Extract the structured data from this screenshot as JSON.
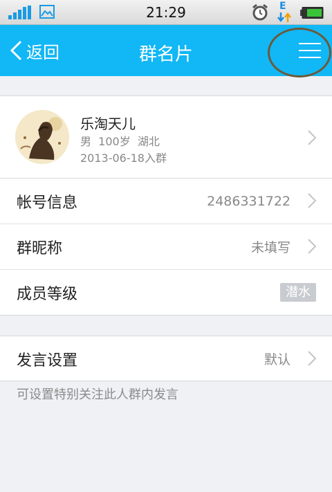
{
  "status_bar": {
    "time": "21:29",
    "icons": [
      "signal-icon",
      "picture-icon",
      "alarm-icon",
      "network-e-icon",
      "battery-icon"
    ],
    "network_letter": "E"
  },
  "nav": {
    "back_label": "返回",
    "title": "群名片",
    "menu_icon": "menu-icon",
    "color": "#12b7f5"
  },
  "member": {
    "name": "乐淘天儿",
    "info": "男  100岁  湖北",
    "joined": "2013-06-18入群"
  },
  "rows": {
    "account": {
      "label": "帐号信息",
      "value": "2486331722"
    },
    "nickname": {
      "label": "群昵称",
      "value": "未填写"
    },
    "level": {
      "label": "成员等级",
      "badge": "潜水"
    },
    "speech": {
      "label": "发言设置",
      "value": "默认"
    }
  },
  "tip": "可设置特别关注此人群内发言"
}
